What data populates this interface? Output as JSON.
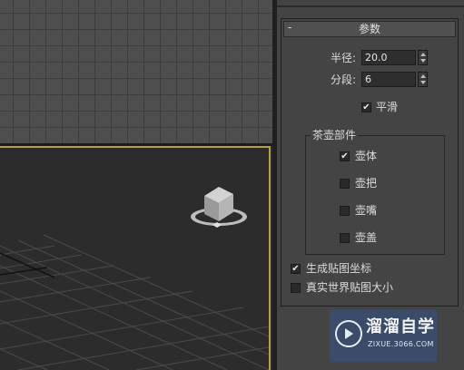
{
  "panel": {
    "rollout_toggle": "-",
    "rollout_title": "参数",
    "radius": {
      "label": "半径:",
      "value": "20.0"
    },
    "segments": {
      "label": "分段:",
      "value": "6"
    },
    "smooth": {
      "label": "平滑",
      "checked": true
    },
    "parts_group": {
      "title": "茶壶部件",
      "items": [
        {
          "label": "壶体",
          "checked": true
        },
        {
          "label": "壶把",
          "checked": false
        },
        {
          "label": "壶嘴",
          "checked": false
        },
        {
          "label": "壶盖",
          "checked": false
        }
      ]
    },
    "gen_mapping": {
      "label": "生成贴图坐标",
      "checked": true
    },
    "real_world": {
      "label": "真实世界贴图大小",
      "checked": false
    }
  },
  "watermark": {
    "name": "溜溜自学",
    "url": "ZIXUE.3066.COM"
  },
  "colors": {
    "active_viewport_border": "#b6a043",
    "panel_bg": "#444444",
    "watermark_bg": "#3b4c6a"
  }
}
